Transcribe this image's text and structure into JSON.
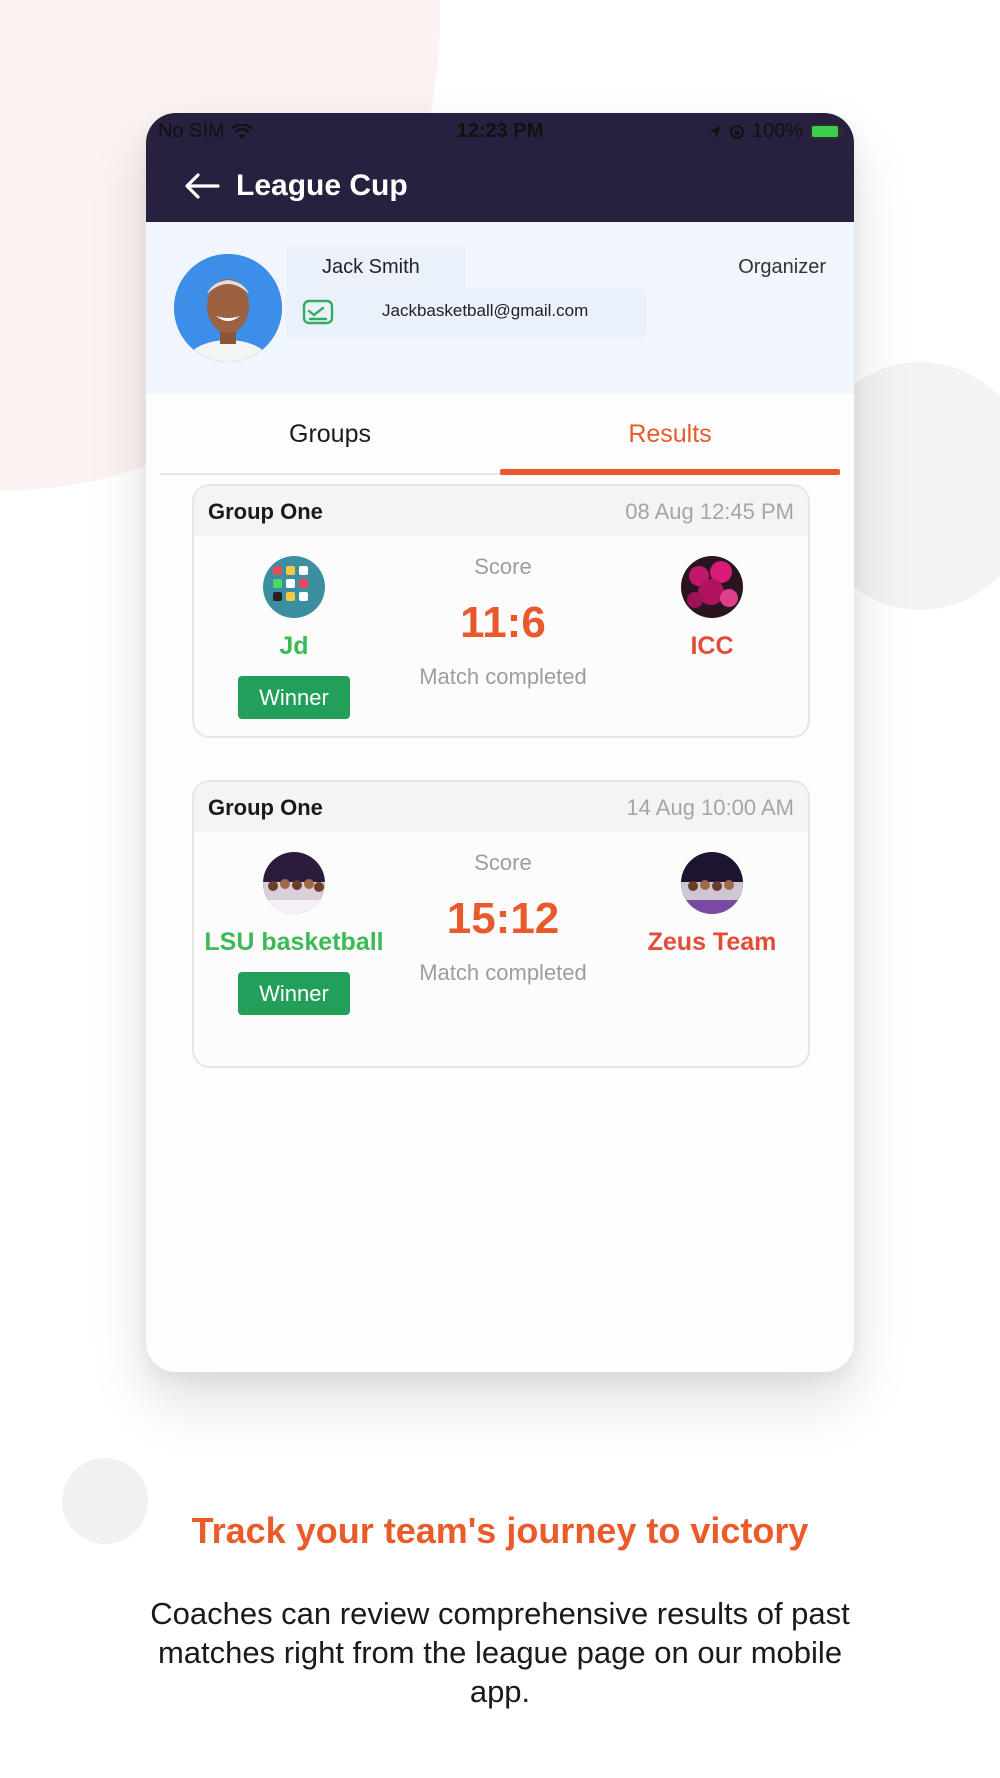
{
  "status_bar": {
    "carrier": "No SIM",
    "time": "12:23 PM",
    "battery": "100%"
  },
  "nav": {
    "title": "League Cup"
  },
  "profile": {
    "name": "Jack Smith",
    "role": "Organizer",
    "email": "Jackbasketball@gmail.com"
  },
  "tabs": [
    {
      "label": "Groups",
      "active": false
    },
    {
      "label": "Results",
      "active": true
    }
  ],
  "matches": [
    {
      "group": "Group One",
      "date": "08 Aug 12:45 PM",
      "home": {
        "name": "Jd",
        "winner_label": "Winner"
      },
      "score_label": "Score",
      "score": "11:6",
      "status": "Match completed",
      "away": {
        "name": "ICC"
      }
    },
    {
      "group": "Group One",
      "date": "14 Aug 10:00 AM",
      "home": {
        "name": "LSU basketball",
        "winner_label": "Winner"
      },
      "score_label": "Score",
      "score": "15:12",
      "status": "Match completed",
      "away": {
        "name": "Zeus Team"
      }
    }
  ],
  "caption": {
    "title": "Track your team's journey to victory",
    "body": "Coaches can review comprehensive results of past matches right from the league page on our mobile app."
  },
  "colors": {
    "accent": "#e8592c",
    "header": "#27203f",
    "winner": "#3bbb55",
    "loser": "#e24d3b",
    "badge": "#22a05a"
  },
  "icons": [
    "wifi-icon",
    "location-icon",
    "rotation-lock-icon",
    "battery-icon",
    "back-arrow-icon",
    "email-icon"
  ]
}
